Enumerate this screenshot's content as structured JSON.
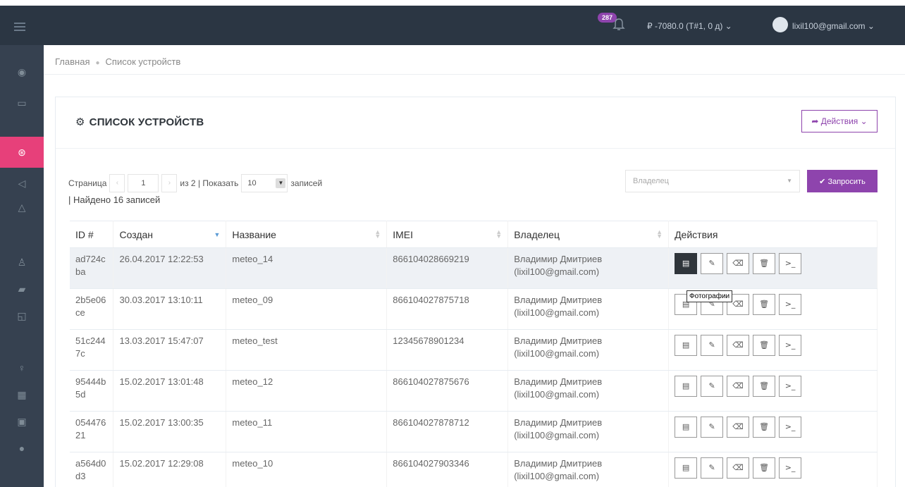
{
  "topbar": {
    "notif_count": "287",
    "balance": "₽ -7080.0 (T#1, 0 д) ⌄",
    "user_email": "lixil100@gmail.com ⌄"
  },
  "breadcrumb": {
    "home": "Главная",
    "current": "Список устройств"
  },
  "portlet": {
    "title": "СПИСОК УСТРОЙСТВ",
    "actions_label": "➦ Действия ⌄"
  },
  "paging": {
    "page_label": "Страница",
    "page_value": "1",
    "of_text": "из 2 | Показать",
    "per_page": "10",
    "records_label": "записей",
    "found_text": "| Найдено 16 записей"
  },
  "filter": {
    "owner_placeholder": "Владелец",
    "query_label": "✔ Запросить"
  },
  "table": {
    "headers": [
      "ID #",
      "Создан",
      "Название",
      "IMEI",
      "Владелец",
      "Действия"
    ],
    "rows": [
      {
        "id": "ad724cba",
        "created": "26.04.2017 12:22:53",
        "name": "meteo_14",
        "imei": "866104028669219",
        "owner": "Владимир Дмитриев (lixil100@gmail.com)"
      },
      {
        "id": "2b5e06ce",
        "created": "30.03.2017 13:10:11",
        "name": "meteo_09",
        "imei": "866104027875718",
        "owner": "Владимир Дмитриев (lixil100@gmail.com)"
      },
      {
        "id": "51c2447c",
        "created": "13.03.2017 15:47:07",
        "name": "meteo_test",
        "imei": "12345678901234",
        "owner": "Владимир Дмитриев (lixil100@gmail.com)"
      },
      {
        "id": "95444b5d",
        "created": "15.02.2017 13:01:48",
        "name": "meteo_12",
        "imei": "866104027875676",
        "owner": "Владимир Дмитриев (lixil100@gmail.com)"
      },
      {
        "id": "05447621",
        "created": "15.02.2017 13:00:35",
        "name": "meteo_11",
        "imei": "866104027878712",
        "owner": "Владимир Дмитриев (lixil100@gmail.com)"
      },
      {
        "id": "a564d0d3",
        "created": "15.02.2017 12:29:08",
        "name": "meteo_10",
        "imei": "866104027903346",
        "owner": "Владимир Дмитриев (lixil100@gmail.com)"
      }
    ]
  },
  "tooltip": "Фотографии"
}
